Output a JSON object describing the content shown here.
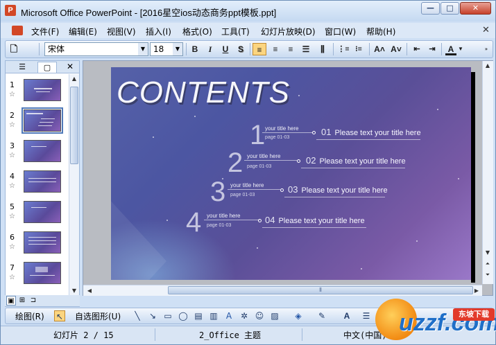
{
  "window": {
    "title": "Microsoft Office PowerPoint - [2016星空ios动态商务ppt模板.ppt]",
    "buttons": {
      "minimize": "—",
      "maximize": "□",
      "close": "✕"
    },
    "app_icon_letter": "P"
  },
  "menu": {
    "items": [
      {
        "label": "文件(F)"
      },
      {
        "label": "编辑(E)"
      },
      {
        "label": "视图(V)"
      },
      {
        "label": "插入(I)"
      },
      {
        "label": "格式(O)"
      },
      {
        "label": "工具(T)"
      },
      {
        "label": "幻灯片放映(D)"
      },
      {
        "label": "窗口(W)"
      },
      {
        "label": "帮助(H)"
      }
    ],
    "close_glyph": "✕"
  },
  "format_toolbar": {
    "font_name": "宋体",
    "font_size": "18",
    "bold": "B",
    "italic": "I",
    "underline": "U",
    "shadow": "S",
    "increase_font": "A˄",
    "decrease_font": "A˅",
    "font_color": "A"
  },
  "left_panel": {
    "tab_outline_glyph": "☰",
    "tab_slides_glyph": "▢",
    "close_glyph": "✕",
    "star_glyph": "☆",
    "thumbnails": [
      {
        "number": "1"
      },
      {
        "number": "2"
      },
      {
        "number": "3"
      },
      {
        "number": "4"
      },
      {
        "number": "5"
      },
      {
        "number": "6"
      },
      {
        "number": "7"
      }
    ]
  },
  "slide": {
    "heading": "CONTENTS",
    "items": [
      {
        "big": "1",
        "small": "your title here",
        "page": "page  01-03",
        "index": "01",
        "title": "Please text your title here"
      },
      {
        "big": "2",
        "small": "your title here",
        "page": "page  01-03",
        "index": "02",
        "title": "Please text your title here"
      },
      {
        "big": "3",
        "small": "your title here",
        "page": "page  01-03",
        "index": "03",
        "title": "Please text your title here"
      },
      {
        "big": "4",
        "small": "your title here",
        "page": "page  01-03",
        "index": "04",
        "title": "Please text your title here"
      }
    ]
  },
  "draw_toolbar": {
    "draw_label": "绘图(R)",
    "autoshapes_label": "自选图形(U)"
  },
  "status": {
    "slide_info": "幻灯片 2 / 15",
    "theme": "2_Office 主题",
    "language": "中文(中国)"
  },
  "watermark": {
    "text": "uzzf.com",
    "badge": "东坡下载"
  }
}
